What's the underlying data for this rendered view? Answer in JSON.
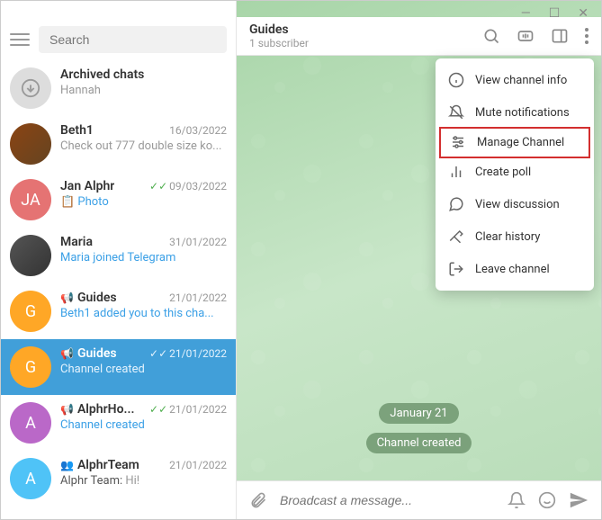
{
  "titlebar": {
    "min": "—",
    "max": "☐",
    "close": "✕"
  },
  "sidebar": {
    "search_placeholder": "Search",
    "items": [
      {
        "name": "Archived chats",
        "preview": "Hannah",
        "date": "",
        "avatar": "archived"
      },
      {
        "name": "Beth1",
        "preview": "Check out 777 double size ko...",
        "date": "16/03/2022",
        "avatar": "photo1"
      },
      {
        "name": "Jan Alphr",
        "preview": "📋 Photo",
        "date": "09/03/2022",
        "avatar": "ja",
        "initials": "JA",
        "checks": true,
        "preview_link": true
      },
      {
        "name": "Maria",
        "preview": "Maria joined Telegram",
        "date": "31/01/2022",
        "avatar": "photo2",
        "preview_link": true
      },
      {
        "name": "Guides",
        "preview": "Beth1 added you to this cha...",
        "date": "21/01/2022",
        "avatar": "g1",
        "initials": "G",
        "type": "📢",
        "preview_link": true
      },
      {
        "name": "Guides",
        "preview": "Channel created",
        "date": "21/01/2022",
        "avatar": "g2",
        "initials": "G",
        "type": "📢",
        "checks": true,
        "selected": true
      },
      {
        "name": "AlphrHo...",
        "preview": "Channel created",
        "date": "21/01/2022",
        "avatar": "a1",
        "initials": "A",
        "type": "📢",
        "checks": true,
        "preview_link": true
      },
      {
        "name": "AlphrTeam",
        "preview_prefix": "Alphr Team: ",
        "preview": "Hi!",
        "date": "21/01/2022",
        "avatar": "a2",
        "initials": "A",
        "type": "👥"
      }
    ]
  },
  "main": {
    "title": "Guides",
    "subtitle": "1 subscriber",
    "date_label": "January 21",
    "sys_label": "Channel created",
    "compose_placeholder": "Broadcast a message..."
  },
  "menu": {
    "items": [
      {
        "icon": "info",
        "label": "View channel info"
      },
      {
        "icon": "mute",
        "label": "Mute notifications"
      },
      {
        "icon": "manage",
        "label": "Manage Channel",
        "highlighted": true
      },
      {
        "icon": "poll",
        "label": "Create poll"
      },
      {
        "icon": "discuss",
        "label": "View discussion"
      },
      {
        "icon": "clear",
        "label": "Clear history"
      },
      {
        "icon": "leave",
        "label": "Leave channel"
      }
    ]
  }
}
